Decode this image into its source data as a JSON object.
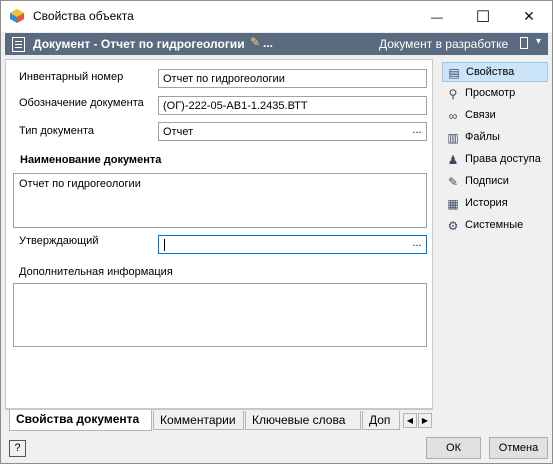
{
  "window": {
    "title": "Свойства объекта",
    "minimize_glyph": "—",
    "maximize_glyph": "☐",
    "close_glyph": "✕"
  },
  "header": {
    "title": "Документ - Отчет по гидрогеологии",
    "edit_icon": "pencil-icon",
    "more_label": "...",
    "status": "Документ в разработке",
    "dropdown_glyph": "▾",
    "bg_color": "#5a6b81"
  },
  "form": {
    "inventory_label": "Инвентарный номер",
    "inventory_value": "Отчет по гидрогеологии",
    "designation_label": "Обозначение документа",
    "designation_value": "(ОГ)-222-05-АВ1-1.2435.ВТТ",
    "type_label": "Тип документа",
    "type_value": "Отчет",
    "type_browse": "...",
    "name_section_title": "Наименование документа",
    "name_value": "Отчет по гидрогеологии",
    "approver_label": "Утверждающий",
    "approver_value": "",
    "approver_browse": "...",
    "extra_label": "Дополнительная информация",
    "extra_value": ""
  },
  "sidebar": {
    "items": [
      {
        "label": "Свойства",
        "icon": "properties-icon",
        "glyph": "▤",
        "selected": true
      },
      {
        "label": "Просмотр",
        "icon": "magnifier-icon",
        "glyph": "⚲",
        "selected": false
      },
      {
        "label": "Связи",
        "icon": "link-icon",
        "glyph": "∞",
        "selected": false
      },
      {
        "label": "Файлы",
        "icon": "files-icon",
        "glyph": "▥",
        "selected": false
      },
      {
        "label": "Права доступа",
        "icon": "access-rights-icon",
        "glyph": "♟",
        "selected": false
      },
      {
        "label": "Подписи",
        "icon": "signature-icon",
        "glyph": "✎",
        "selected": false
      },
      {
        "label": "История",
        "icon": "history-icon",
        "glyph": "▦",
        "selected": false
      },
      {
        "label": "Системные",
        "icon": "system-gear-icon",
        "glyph": "⚙",
        "selected": false
      }
    ],
    "selected_bg": "#cce4f7"
  },
  "tabs": {
    "items": [
      "Свойства документа",
      "Комментарии",
      "Ключевые слова",
      "Доп"
    ],
    "active": 0,
    "prev_glyph": "◀",
    "next_glyph": "▶"
  },
  "footer": {
    "help_label": "?",
    "ok_label": "ОК",
    "cancel_label": "Отмена"
  }
}
